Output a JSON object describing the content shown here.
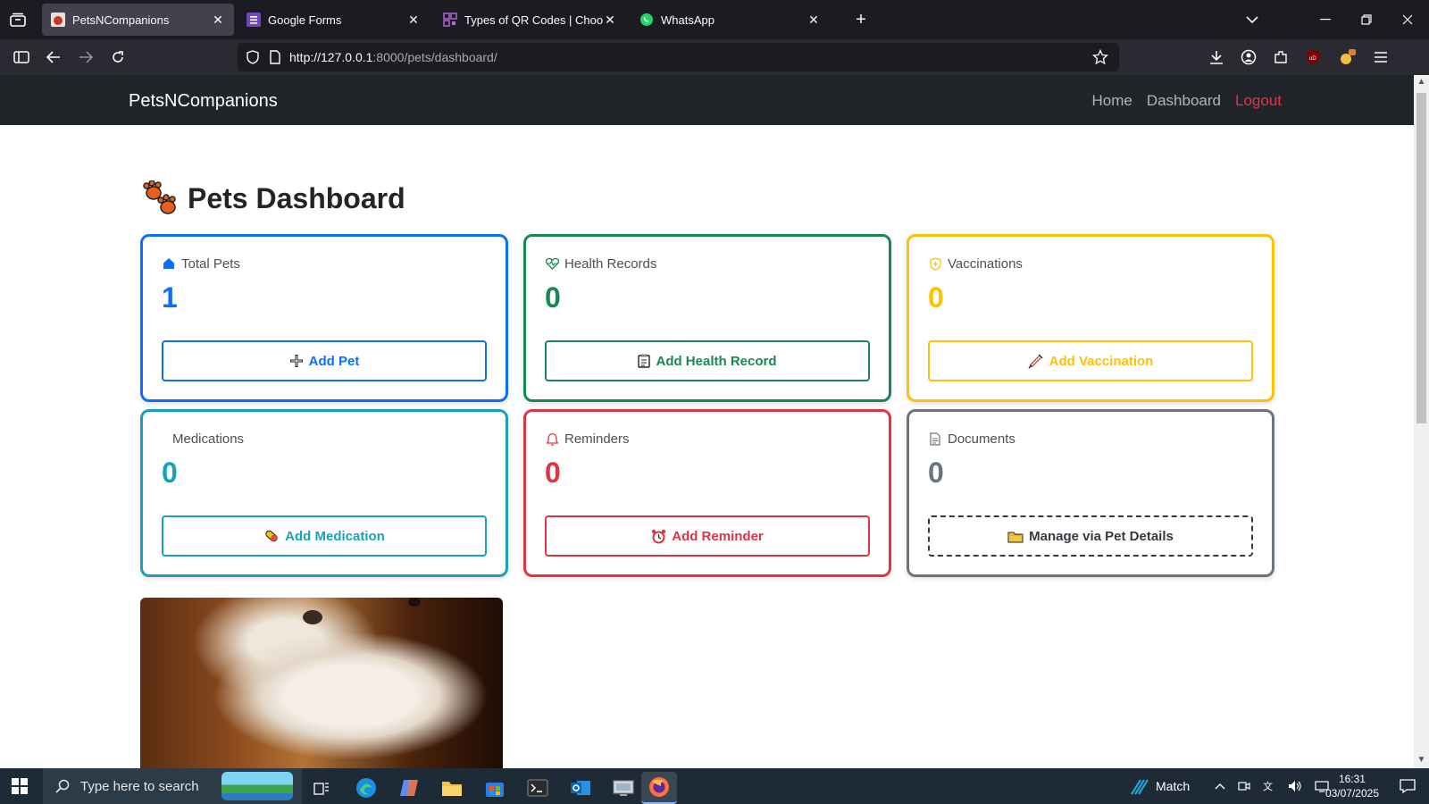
{
  "browser": {
    "tabs": [
      {
        "title": "PetsNCompanions",
        "active": true
      },
      {
        "title": "Google Forms",
        "active": false
      },
      {
        "title": "Types of QR Codes | Choose diff",
        "active": false
      },
      {
        "title": "WhatsApp",
        "active": false
      }
    ],
    "url_host": "http://127.0.0.1",
    "url_rest": ":8000/pets/dashboard/"
  },
  "site": {
    "brand": "PetsNCompanions",
    "nav": {
      "home": "Home",
      "dashboard": "Dashboard",
      "logout": "Logout"
    }
  },
  "page": {
    "title": "Pets Dashboard",
    "cards": [
      {
        "label": "Total Pets",
        "value": "1",
        "button": "Add Pet",
        "icon": "house-icon",
        "button_icon": "plus-icon",
        "color": "#0d6efd"
      },
      {
        "label": "Health Records",
        "value": "0",
        "button": "Add Health Record",
        "icon": "heart-pulse-icon",
        "button_icon": "clipboard-icon",
        "color": "#198754"
      },
      {
        "label": "Vaccinations",
        "value": "0",
        "button": "Add Vaccination",
        "icon": "shield-icon",
        "button_icon": "syringe-icon",
        "color": "#ffc107"
      },
      {
        "label": "Medications",
        "value": "0",
        "button": "Add Medication",
        "icon": "none",
        "button_icon": "pill-icon",
        "color": "#17a2b8"
      },
      {
        "label": "Reminders",
        "value": "0",
        "button": "Add Reminder",
        "icon": "bell-icon",
        "button_icon": "alarm-clock-icon",
        "color": "#dc3545"
      },
      {
        "label": "Documents",
        "value": "0",
        "button": "Manage via Pet Details",
        "icon": "document-icon",
        "button_icon": "folder-icon",
        "color": "#6c757d"
      }
    ]
  },
  "taskbar": {
    "search_placeholder": "Type here to search",
    "weather_label": "Match",
    "time": "16:31",
    "date": "03/07/2025"
  }
}
